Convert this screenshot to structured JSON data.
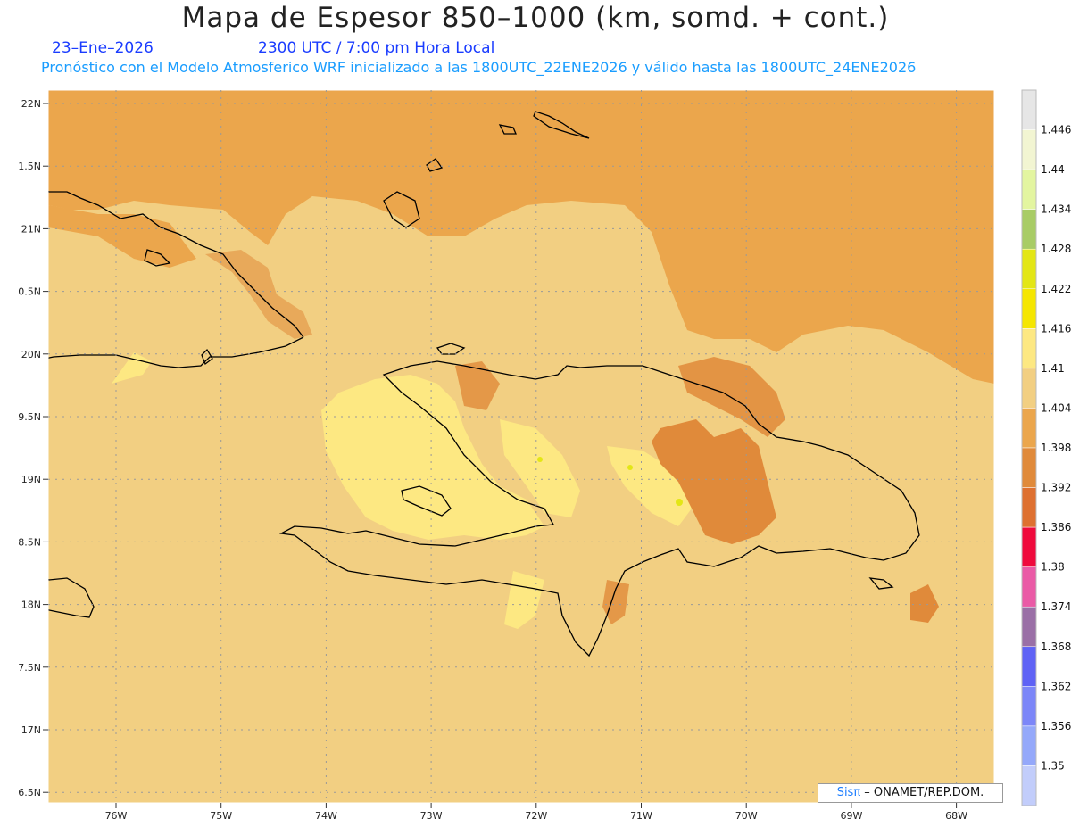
{
  "title": "Mapa de Espesor 850–1000 (km, somd. + cont.)",
  "date_label": "23–Ene–2026",
  "time_label": "2300 UTC / 7:00 pm Hora Local",
  "forecast_label": "Pronóstico con el Modelo Atmosferico WRF inicializado a las 1800UTC_22ENE2026 y válido hasta las  1800UTC_24ENE2026",
  "lat_labels": [
    "22N",
    "1.5N",
    "21N",
    "0.5N",
    "20N",
    "9.5N",
    "19N",
    "8.5N",
    "18N",
    "7.5N",
    "17N",
    "6.5N"
  ],
  "lon_labels": [
    "76W",
    "75W",
    "74W",
    "73W",
    "72W",
    "71W",
    "70W",
    "69W",
    "68W"
  ],
  "colorbar": {
    "labels": [
      "1.446",
      "1.44",
      "1.434",
      "1.428",
      "1.422",
      "1.416",
      "1.41",
      "1.404",
      "1.398",
      "1.392",
      "1.386",
      "1.38",
      "1.374",
      "1.368",
      "1.362",
      "1.356",
      "1.35"
    ],
    "colors": [
      "#e6e6e6",
      "#f2f5d2",
      "#e3f5a0",
      "#a8cc66",
      "#e3e615",
      "#f5e600",
      "#fde882",
      "#f2cf82",
      "#eba64c",
      "#e08a3a",
      "#de7030",
      "#ef0a3c",
      "#ea5aa6",
      "#9a6fa6",
      "#5f62f5",
      "#7c86f8",
      "#94a8fa",
      "#c2cdfb"
    ]
  },
  "credit": {
    "brand": "Sisπ",
    "text": " – ONAMET/REP.DOM."
  },
  "colors": {
    "low_band": "#f2cf82",
    "mid_band": "#eba64c",
    "warm_band": "#fde882",
    "hot_band": "#e08a3a",
    "coast": "#000000"
  }
}
